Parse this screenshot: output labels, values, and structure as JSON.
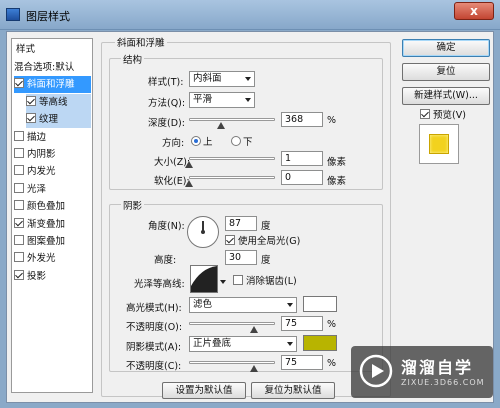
{
  "window": {
    "title": "图层样式",
    "close_label": "x"
  },
  "sidebar": {
    "header": "样式",
    "items": [
      {
        "label": "混合选项:默认",
        "checkbox": false,
        "checked": false,
        "state": "normal"
      },
      {
        "label": "斜面和浮雕",
        "checkbox": true,
        "checked": true,
        "state": "selected"
      },
      {
        "label": "等高线",
        "checkbox": true,
        "checked": true,
        "state": "sub"
      },
      {
        "label": "纹理",
        "checkbox": true,
        "checked": true,
        "state": "sub"
      },
      {
        "label": "描边",
        "checkbox": true,
        "checked": false,
        "state": "normal"
      },
      {
        "label": "内阴影",
        "checkbox": true,
        "checked": false,
        "state": "normal"
      },
      {
        "label": "内发光",
        "checkbox": true,
        "checked": false,
        "state": "normal"
      },
      {
        "label": "光泽",
        "checkbox": true,
        "checked": false,
        "state": "normal"
      },
      {
        "label": "颜色叠加",
        "checkbox": true,
        "checked": false,
        "state": "normal"
      },
      {
        "label": "渐变叠加",
        "checkbox": true,
        "checked": true,
        "state": "normal"
      },
      {
        "label": "图案叠加",
        "checkbox": true,
        "checked": false,
        "state": "normal"
      },
      {
        "label": "外发光",
        "checkbox": true,
        "checked": false,
        "state": "normal"
      },
      {
        "label": "投影",
        "checkbox": true,
        "checked": true,
        "state": "normal"
      }
    ]
  },
  "bevel": {
    "title": "斜面和浮雕",
    "structure": {
      "title": "结构",
      "style_label": "样式(T):",
      "style_value": "内斜面",
      "technique_label": "方法(Q):",
      "technique_value": "平滑",
      "depth_label": "深度(D):",
      "depth_value": "368",
      "depth_unit": "%",
      "depth_fraction": 0.37,
      "direction_label": "方向:",
      "dir_up": "上",
      "dir_down": "下",
      "direction_selected": "上",
      "size_label": "大小(Z):",
      "size_value": "1",
      "size_unit": "像素",
      "size_fraction": 0.0,
      "soften_label": "软化(E):",
      "soften_value": "0",
      "soften_unit": "像素",
      "soften_fraction": 0.0
    },
    "shading": {
      "title": "阴影",
      "angle_label": "角度(N):",
      "angle_value": "87",
      "angle_unit": "度",
      "global_light_label": "使用全局光(G)",
      "global_light_checked": true,
      "altitude_label": "高度:",
      "altitude_value": "30",
      "altitude_unit": "度",
      "gloss_label": "光泽等高线:",
      "antialias_label": "消除锯齿(L)",
      "antialias_checked": false,
      "highlight_mode_label": "高光模式(H):",
      "highlight_mode_value": "滤色",
      "highlight_color": "#ffffff",
      "highlight_opacity_label": "不透明度(O):",
      "highlight_opacity_value": "75",
      "highlight_opacity_unit": "%",
      "highlight_opacity_fraction": 0.75,
      "shadow_mode_label": "阴影模式(A):",
      "shadow_mode_value": "正片叠底",
      "shadow_color": "#b8b400",
      "shadow_opacity_label": "不透明度(C):",
      "shadow_opacity_value": "75",
      "shadow_opacity_unit": "%",
      "shadow_opacity_fraction": 0.75
    },
    "make_default": "设置为默认值",
    "reset_default": "复位为默认值"
  },
  "right": {
    "ok": "确定",
    "reset": "复位",
    "new_style": "新建样式(W)...",
    "preview_label": "预览(V)",
    "preview_checked": true,
    "preview_color": "#f2d21e"
  },
  "watermark": {
    "name": "溜溜自学",
    "url": "ZIXUE.3D66.COM"
  }
}
